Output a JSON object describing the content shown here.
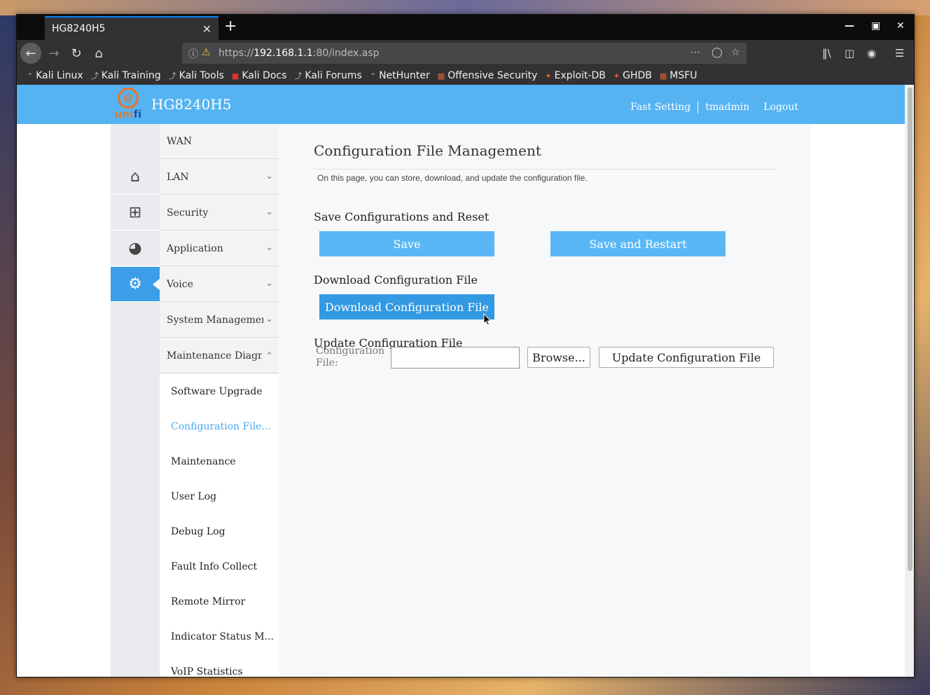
{
  "browser": {
    "tab_title": "HG8240H5",
    "tab_close": "✕",
    "new_tab": "+",
    "url_scheme": "https://",
    "url_host": "192.168.1.1",
    "url_rest": ":80/index.asp",
    "bookmarks": [
      {
        "label": "Kali Linux"
      },
      {
        "label": "Kali Training"
      },
      {
        "label": "Kali Tools"
      },
      {
        "label": "Kali Docs"
      },
      {
        "label": "Kali Forums"
      },
      {
        "label": "NetHunter"
      },
      {
        "label": "Offensive Security"
      },
      {
        "label": "Exploit-DB"
      },
      {
        "label": "GHDB"
      },
      {
        "label": "MSFU"
      }
    ]
  },
  "header": {
    "logo_text_a": "uni",
    "logo_text_b": "fi",
    "model": "HG8240H5",
    "links": [
      "Fast Setting",
      "tmadmin",
      "Logout"
    ]
  },
  "menu": {
    "items": [
      "WAN",
      "LAN",
      "Security",
      "Application",
      "Voice",
      "System Management",
      "Maintenance Diagnosis"
    ],
    "subitems": [
      "Software Upgrade",
      "Configuration File...",
      "Maintenance",
      "User Log",
      "Debug Log",
      "Fault Info Collect",
      "Remote Mirror",
      "Indicator Status M...",
      "VoIP Statistics"
    ]
  },
  "content": {
    "title": "Configuration File Management",
    "description": "On this page, you can store, download, and update the configuration file.",
    "save_section": "Save Configurations and Reset",
    "save_btn": "Save",
    "save_restart_btn": "Save and Restart",
    "download_section": "Download Configuration File",
    "download_btn": "Download Configuration File",
    "update_section": "Update Configuration File",
    "config_label_1": "Configuration",
    "config_label_2": "File:",
    "config_value": "",
    "browse_btn": "Browse...",
    "update_btn": "Update Configuration File"
  }
}
